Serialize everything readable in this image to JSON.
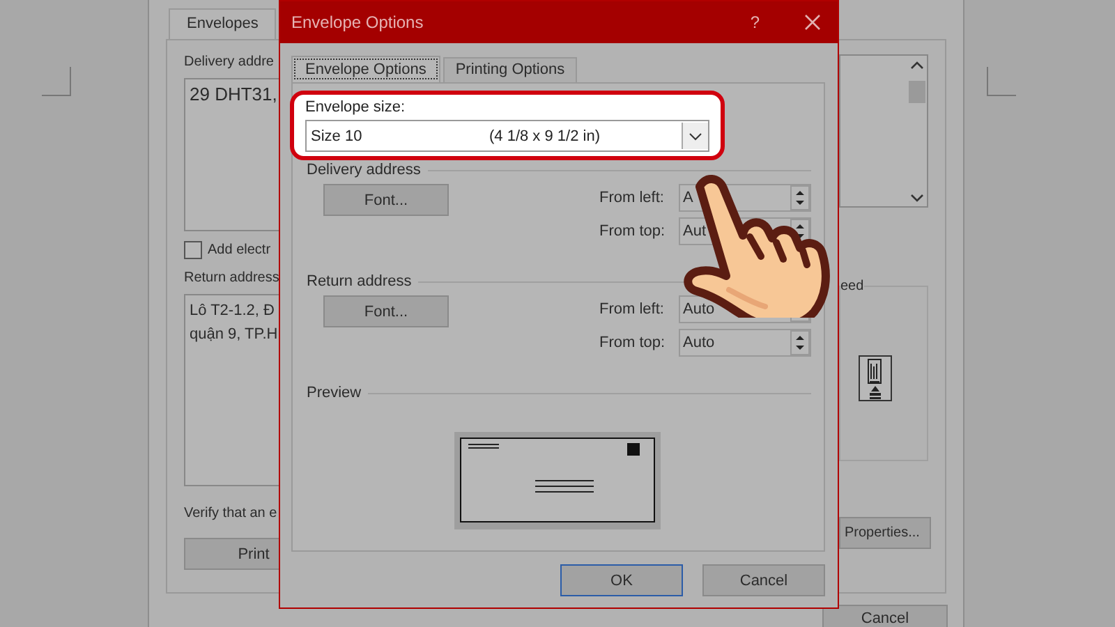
{
  "background_dialog": {
    "tab": "Envelopes",
    "delivery_label": "Delivery addre",
    "delivery_text": "29 DHT31,",
    "add_checkbox": {
      "label": "Add electr",
      "checked": false
    },
    "return_label": "Return address",
    "return_lines": [
      "Lô T2-1.2, Đ",
      "quận 9, TP.H"
    ],
    "verify_text": "Verify that an e",
    "print_button": "Print",
    "feed_label": "eed",
    "properties_button": "Properties...",
    "cancel_button": "Cancel"
  },
  "dialog": {
    "title": "Envelope Options",
    "help": "?",
    "tabs": [
      {
        "label": "Envelope Options",
        "selected": true
      },
      {
        "label": "Printing Options",
        "selected": false
      }
    ],
    "envelope_size": {
      "label": "Envelope size:",
      "value": "Size 10",
      "dimensions": "(4 1/8 x 9 1/2 in)"
    },
    "sections": [
      {
        "title": "Delivery address",
        "font_button": "Font...",
        "from_left": {
          "label": "From left:",
          "value": "A"
        },
        "from_top": {
          "label": "From top:",
          "value": "Aut"
        }
      },
      {
        "title": "Return address",
        "font_button": "Font...",
        "from_left": {
          "label": "From left:",
          "value": "Auto"
        },
        "from_top": {
          "label": "From top:",
          "value": "Auto"
        }
      }
    ],
    "preview_label": "Preview",
    "buttons": [
      "OK",
      "Cancel"
    ]
  }
}
